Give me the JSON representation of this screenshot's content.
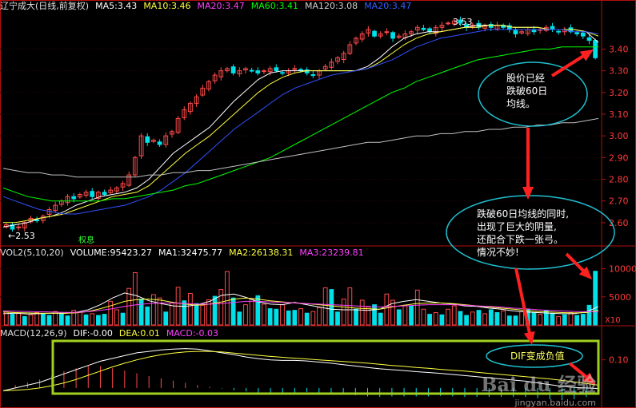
{
  "header": {
    "title": "辽宁成大(日线,前复权)",
    "ma5": "MA5:3.43",
    "ma10": "MA10:3.46",
    "ma20": "MA20:3.47",
    "ma60": "MA60:3.41",
    "ma120": "MA120:3.08",
    "ma20b": "MA20:3.47"
  },
  "volume_header": {
    "title": "VOL2(5,10,20)",
    "volume": "VOLUME:95423.27",
    "ma1": "MA1:32475.77",
    "ma2": "MA2:26138.31",
    "ma3": "MA3:23239.81"
  },
  "macd_header": {
    "title": "MACD(12,26,9)",
    "dif": "DIF:-0.00",
    "dea": "DEA:0.01",
    "macd": "MACD:-0.03"
  },
  "annotations": {
    "low_label": "←2.53",
    "high_label": "3.53",
    "rights_label": "权息",
    "callout1": [
      "股价已经",
      "跌破60日",
      "均线。"
    ],
    "callout2": [
      "跌破60日均线的同时,",
      "出现了巨大的阴量,",
      "还配合下跌一张弓。",
      "情况不妙!"
    ],
    "callout3": "DIF变成负值",
    "vol_scale": "X10"
  },
  "watermark": {
    "brand": "Bai du 经验",
    "url": "jingyan.baidu.com"
  },
  "colors": {
    "up": "#ff4a4a",
    "down": "#00e0e8",
    "ma5": "#ffffff",
    "ma10": "#ffff40",
    "ma20": "#ff40ff",
    "ma60": "#00ff00",
    "ma120": "#c0c0c0",
    "ma20b": "#3050ff",
    "axis": "#b01010",
    "box": "#a0d020"
  },
  "chart_data": [
    {
      "type": "candlestick",
      "title": "辽宁成大(日线,前复权)",
      "price_ticks": [
        2.6,
        2.7,
        2.8,
        2.9,
        3.0,
        3.1,
        3.2,
        3.3,
        3.4
      ],
      "ylim": [
        2.5,
        3.56
      ],
      "closes": [
        2.59,
        2.57,
        2.58,
        2.6,
        2.62,
        2.61,
        2.63,
        2.66,
        2.68,
        2.7,
        2.72,
        2.71,
        2.73,
        2.74,
        2.72,
        2.74,
        2.73,
        2.75,
        2.76,
        2.78,
        2.82,
        2.9,
        3.0,
        2.97,
        2.98,
        2.96,
        3.0,
        3.02,
        3.08,
        3.12,
        3.15,
        3.18,
        3.22,
        3.25,
        3.28,
        3.3,
        3.31,
        3.29,
        3.3,
        3.31,
        3.3,
        3.29,
        3.3,
        3.31,
        3.3,
        3.29,
        3.3,
        3.31,
        3.3,
        3.29,
        3.28,
        3.3,
        3.32,
        3.34,
        3.36,
        3.38,
        3.42,
        3.45,
        3.47,
        3.49,
        3.46,
        3.47,
        3.48,
        3.45,
        3.46,
        3.47,
        3.48,
        3.5,
        3.49,
        3.48,
        3.5,
        3.51,
        3.52,
        3.53,
        3.52,
        3.5,
        3.51,
        3.5,
        3.51,
        3.5,
        3.51,
        3.5,
        3.49,
        3.47,
        3.48,
        3.49,
        3.48,
        3.49,
        3.5,
        3.49,
        3.48,
        3.49,
        3.48,
        3.47,
        3.46,
        3.44,
        3.36
      ],
      "series": [
        {
          "name": "MA5",
          "values": [
            2.58,
            2.59,
            2.6,
            2.62,
            2.63,
            2.65,
            2.68,
            2.7,
            2.72,
            2.73,
            2.74,
            2.76,
            2.8,
            2.86,
            2.92,
            2.96,
            3.0,
            3.04,
            3.1,
            3.16,
            3.21,
            3.26,
            3.29,
            3.3,
            3.3,
            3.3,
            3.3,
            3.3,
            3.3,
            3.3,
            3.32,
            3.36,
            3.41,
            3.45,
            3.47,
            3.48,
            3.48,
            3.49,
            3.5,
            3.51,
            3.51,
            3.51,
            3.5,
            3.5,
            3.5,
            3.49,
            3.49,
            3.49,
            3.48,
            3.43
          ]
        },
        {
          "name": "MA10",
          "values": [
            2.6,
            2.6,
            2.61,
            2.62,
            2.63,
            2.64,
            2.66,
            2.68,
            2.7,
            2.72,
            2.73,
            2.74,
            2.77,
            2.82,
            2.87,
            2.92,
            2.96,
            3.0,
            3.05,
            3.1,
            3.15,
            3.2,
            3.24,
            3.27,
            3.29,
            3.3,
            3.3,
            3.3,
            3.3,
            3.3,
            3.31,
            3.34,
            3.38,
            3.42,
            3.45,
            3.47,
            3.48,
            3.49,
            3.5,
            3.5,
            3.51,
            3.51,
            3.5,
            3.5,
            3.5,
            3.49,
            3.49,
            3.49,
            3.48,
            3.46
          ]
        },
        {
          "name": "MA20",
          "values": [
            2.72,
            2.7,
            2.68,
            2.66,
            2.65,
            2.64,
            2.64,
            2.65,
            2.66,
            2.67,
            2.68,
            2.7,
            2.72,
            2.75,
            2.79,
            2.83,
            2.88,
            2.93,
            2.98,
            3.03,
            3.07,
            3.11,
            3.15,
            3.19,
            3.22,
            3.24,
            3.26,
            3.28,
            3.29,
            3.3,
            3.31,
            3.33,
            3.35,
            3.38,
            3.41,
            3.43,
            3.45,
            3.46,
            3.47,
            3.48,
            3.49,
            3.49,
            3.49,
            3.49,
            3.49,
            3.49,
            3.49,
            3.48,
            3.48,
            3.47
          ]
        },
        {
          "name": "MA60",
          "values": [
            2.76,
            2.74,
            2.72,
            2.71,
            2.7,
            2.7,
            2.7,
            2.7,
            2.7,
            2.71,
            2.71,
            2.72,
            2.73,
            2.74,
            2.75,
            2.77,
            2.78,
            2.8,
            2.82,
            2.84,
            2.86,
            2.88,
            2.9,
            2.93,
            2.96,
            2.99,
            3.02,
            3.05,
            3.08,
            3.11,
            3.14,
            3.17,
            3.2,
            3.22,
            3.25,
            3.27,
            3.29,
            3.31,
            3.33,
            3.35,
            3.36,
            3.37,
            3.38,
            3.39,
            3.4,
            3.4,
            3.41,
            3.41,
            3.41,
            3.41
          ]
        },
        {
          "name": "MA120",
          "values": [
            2.85,
            2.84,
            2.83,
            2.83,
            2.82,
            2.82,
            2.81,
            2.81,
            2.81,
            2.81,
            2.81,
            2.81,
            2.82,
            2.82,
            2.83,
            2.83,
            2.84,
            2.84,
            2.85,
            2.86,
            2.87,
            2.88,
            2.89,
            2.9,
            2.91,
            2.92,
            2.93,
            2.94,
            2.95,
            2.96,
            2.97,
            2.97,
            2.98,
            2.99,
            3.0,
            3.0,
            3.01,
            3.01,
            3.02,
            3.02,
            3.03,
            3.03,
            3.04,
            3.04,
            3.05,
            3.05,
            3.06,
            3.06,
            3.07,
            3.08
          ]
        }
      ]
    },
    {
      "type": "bar",
      "title": "VOL2(5,10,20)",
      "volume_ticks": [
        5000,
        10000
      ],
      "ylim": [
        0,
        11500
      ],
      "values": [
        2300,
        1900,
        2100,
        1500,
        1800,
        2200,
        2000,
        1700,
        2400,
        2100,
        1600,
        2600,
        2300,
        1800,
        2000,
        1700,
        1900,
        4200,
        2700,
        2100,
        6500,
        9300,
        4600,
        3200,
        5400,
        4800,
        2300,
        3900,
        6700,
        4300,
        5600,
        3800,
        3500,
        4500,
        5100,
        6300,
        9500,
        4800,
        2300,
        3600,
        4700,
        5200,
        3700,
        2900,
        2800,
        3600,
        2500,
        2600,
        2900,
        2100,
        2400,
        3100,
        6600,
        6300,
        2300,
        4600,
        6600,
        2800,
        4400,
        3200,
        3600,
        2100,
        5500,
        4400,
        2700,
        3500,
        3400,
        6200,
        2800,
        1900,
        2200,
        1800,
        2800,
        3400,
        2400,
        1700,
        2300,
        2600,
        2000,
        2700,
        2200,
        2500,
        1600,
        1600,
        2400,
        2700,
        2200,
        1900,
        2600,
        2000,
        1500,
        1800,
        2200,
        1700,
        1900,
        3500,
        9550
      ],
      "ups": [
        1,
        0,
        1,
        0,
        1,
        1,
        0,
        0,
        1,
        0,
        0,
        1,
        1,
        0,
        1,
        0,
        0,
        1,
        1,
        0,
        1,
        1,
        0,
        0,
        1,
        1,
        0,
        1,
        1,
        0,
        1,
        0,
        1,
        1,
        0,
        1,
        1,
        0,
        0,
        1,
        1,
        0,
        1,
        0,
        0,
        1,
        0,
        0,
        1,
        0,
        1,
        1,
        1,
        0,
        0,
        1,
        1,
        0,
        1,
        1,
        0,
        0,
        1,
        1,
        0,
        1,
        0,
        1,
        1,
        0,
        1,
        0,
        1,
        1,
        0,
        0,
        1,
        0,
        1,
        0,
        0,
        1,
        0,
        0,
        1,
        0,
        0,
        1,
        0,
        0,
        1,
        0,
        1,
        0,
        0,
        0,
        0
      ],
      "series": [
        {
          "name": "MA1",
          "values": [
            2000,
            2100,
            1950,
            2000,
            2100,
            2050,
            2250,
            2700,
            3600,
            4800,
            5700,
            5200,
            4300,
            3800,
            3400,
            3300,
            3600,
            4200,
            5300,
            5500,
            4900,
            4100,
            3700,
            3600,
            4000,
            3600,
            3200,
            2800,
            2700,
            2700,
            2600,
            2800,
            3800,
            4200,
            4500,
            4200,
            3900,
            3700,
            3400,
            3300,
            3000,
            2800,
            2500,
            2300,
            2200,
            2100,
            2000,
            2000,
            2300,
            3250
          ]
        },
        {
          "name": "MA2",
          "values": [
            2300,
            2200,
            2150,
            2100,
            2100,
            2100,
            2150,
            2400,
            2900,
            3500,
            4200,
            4500,
            4600,
            4400,
            4000,
            3700,
            3500,
            3700,
            4100,
            4600,
            4800,
            4600,
            4300,
            4100,
            3900,
            3800,
            3600,
            3400,
            3200,
            3000,
            2900,
            2800,
            3200,
            3500,
            3800,
            3900,
            3900,
            3800,
            3600,
            3400,
            3200,
            3000,
            2800,
            2600,
            2400,
            2300,
            2200,
            2150,
            2200,
            2600
          ]
        },
        {
          "name": "MA3",
          "values": [
            2500,
            2450,
            2400,
            2350,
            2300,
            2250,
            2250,
            2350,
            2600,
            2900,
            3300,
            3600,
            3800,
            3900,
            3900,
            3800,
            3700,
            3700,
            3800,
            4000,
            4200,
            4200,
            4100,
            4000,
            3900,
            3800,
            3700,
            3600,
            3500,
            3400,
            3300,
            3200,
            3300,
            3400,
            3500,
            3600,
            3600,
            3600,
            3500,
            3400,
            3300,
            3200,
            3000,
            2900,
            2700,
            2600,
            2500,
            2400,
            2350,
            2320
          ]
        }
      ]
    },
    {
      "type": "line",
      "title": "MACD(12,26,9)",
      "macd_ticks": [
        0.1
      ],
      "ylim": [
        -0.04,
        0.17
      ],
      "series": [
        {
          "name": "DIF",
          "values": [
            -0.01,
            0.0,
            0.01,
            0.02,
            0.035,
            0.05,
            0.065,
            0.08,
            0.095,
            0.105,
            0.115,
            0.125,
            0.13,
            0.135,
            0.138,
            0.14,
            0.138,
            0.132,
            0.125,
            0.118,
            0.11,
            0.104,
            0.1,
            0.098,
            0.098,
            0.096,
            0.092,
            0.088,
            0.083,
            0.078,
            0.073,
            0.068,
            0.065,
            0.062,
            0.058,
            0.055,
            0.052,
            0.048,
            0.044,
            0.04,
            0.036,
            0.032,
            0.028,
            0.024,
            0.018,
            0.012,
            0.006,
            0.002,
            0.0,
            -0.002
          ]
        },
        {
          "name": "DEA",
          "values": [
            -0.01,
            -0.008,
            -0.005,
            0.0,
            0.008,
            0.018,
            0.03,
            0.045,
            0.06,
            0.075,
            0.088,
            0.1,
            0.11,
            0.118,
            0.124,
            0.128,
            0.13,
            0.13,
            0.128,
            0.124,
            0.12,
            0.116,
            0.112,
            0.109,
            0.106,
            0.103,
            0.1,
            0.097,
            0.094,
            0.091,
            0.088,
            0.084,
            0.08,
            0.077,
            0.073,
            0.07,
            0.066,
            0.063,
            0.06,
            0.056,
            0.052,
            0.048,
            0.044,
            0.04,
            0.036,
            0.032,
            0.027,
            0.022,
            0.016,
            0.01
          ]
        },
        {
          "name": "MACD",
          "values": [
            0.0,
            0.01,
            0.02,
            0.03,
            0.045,
            0.06,
            0.07,
            0.078,
            0.078,
            0.07,
            0.062,
            0.052,
            0.042,
            0.034,
            0.026,
            0.018,
            0.01,
            0.004,
            -0.002,
            -0.008,
            -0.012,
            -0.016,
            -0.018,
            -0.018,
            -0.016,
            -0.014,
            -0.016,
            -0.018,
            -0.022,
            -0.026,
            -0.03,
            -0.032,
            -0.03,
            -0.03,
            -0.03,
            -0.03,
            -0.028,
            -0.03,
            -0.032,
            -0.032,
            -0.032,
            -0.032,
            -0.032,
            -0.032,
            -0.036,
            -0.04,
            -0.042,
            -0.04,
            -0.032,
            -0.024
          ]
        }
      ]
    }
  ]
}
